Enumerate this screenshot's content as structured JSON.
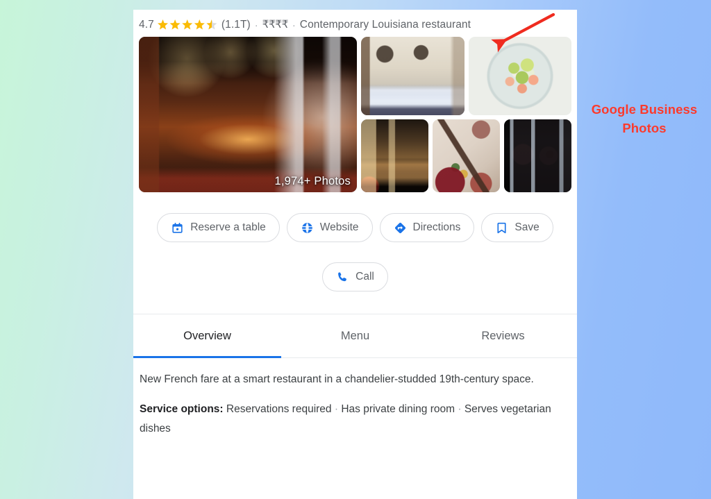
{
  "background": {
    "gradient_from": "#c7f5d9",
    "gradient_to": "#93bcfa"
  },
  "annotation": {
    "text_line1": "Google Business",
    "text_line2": "Photos",
    "color": "#fc3a2c",
    "arrow_icon": "arrow-down-left-icon"
  },
  "panel": {
    "header": {
      "rating_score": "4.7",
      "stars_filled": 4.5,
      "star_color": "#fabb05",
      "rating_count": "(1.1T)",
      "separator": "·",
      "price_range": "₹₹₹₹",
      "category": "Contemporary Louisiana restaurant"
    },
    "photos": {
      "badge": "1,974+ Photos",
      "main": {
        "name": "photo-bar-interior",
        "alt": "Wood-paneled bar interior"
      },
      "thumbnails": [
        {
          "name": "photo-dining-room",
          "alt": "Long white-clothed dining table"
        },
        {
          "name": "photo-salad-dish",
          "alt": "Shrimp and avocado salad plate"
        },
        {
          "name": "photo-building-facade",
          "alt": "Lit building facade at night"
        },
        {
          "name": "photo-table-setting",
          "alt": "Overhead table setting"
        },
        {
          "name": "photo-storefront",
          "alt": "Storefront windows with wreaths"
        }
      ]
    },
    "actions": [
      {
        "label": "Reserve a table",
        "icon": "calendar-icon",
        "name": "reserve-a-table-button"
      },
      {
        "label": "Website",
        "icon": "globe-icon",
        "name": "website-button"
      },
      {
        "label": "Directions",
        "icon": "directions-diamond-icon",
        "name": "directions-button"
      },
      {
        "label": "Save",
        "icon": "bookmark-icon",
        "name": "save-button"
      }
    ],
    "call": {
      "label": "Call",
      "icon": "phone-icon"
    },
    "tabs": [
      {
        "label": "Overview",
        "active": true
      },
      {
        "label": "Menu",
        "active": false
      },
      {
        "label": "Reviews",
        "active": false
      }
    ],
    "overview": {
      "description": "New French fare at a smart restaurant in a chandelier-studded 19th-century space.",
      "service_options_label": "Service options:",
      "service_options_items": [
        "Reservations required",
        "Has private dining room",
        "Serves vegetarian dishes"
      ]
    },
    "accent_color": "#1a73e8"
  }
}
